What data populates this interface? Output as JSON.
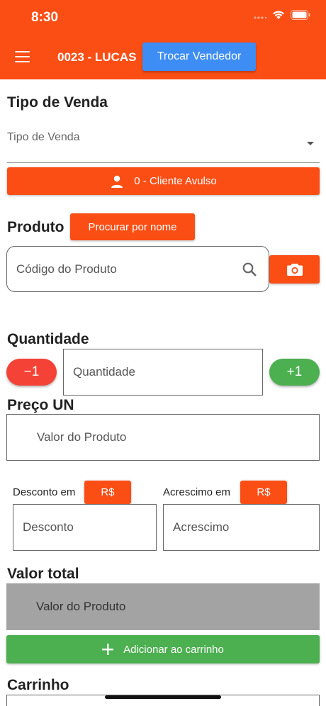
{
  "status_bar": {
    "time": "8:30"
  },
  "appbar": {
    "vendor": "0023 - LUCAS",
    "switch_vendor_label": "Trocar Vendedor"
  },
  "sale_type": {
    "heading": "Tipo de Venda",
    "placeholder": "Tipo de Venda"
  },
  "customer": {
    "label": "0 - Cliente Avulso"
  },
  "product": {
    "heading": "Produto",
    "search_by_name_label": "Procurar por nome",
    "code_placeholder": "Código do Produto"
  },
  "quantity": {
    "heading": "Quantidade",
    "minus_label": "−1",
    "placeholder": "Quantidade",
    "plus_label": "+1"
  },
  "unit_price": {
    "heading": "Preço UN",
    "placeholder": "Valor do Produto"
  },
  "discount": {
    "label": "Desconto em",
    "unit_label": "R$",
    "placeholder": "Desconto"
  },
  "surcharge": {
    "label": "Acrescimo em",
    "unit_label": "R$",
    "placeholder": "Acrescimo"
  },
  "total": {
    "heading": "Valor total",
    "placeholder": "Valor do Produto"
  },
  "cart": {
    "add_label": "Adicionar ao carrinho",
    "heading": "Carrinho"
  },
  "colors": {
    "primary": "#fa4e15",
    "accent_blue": "#3d8df5",
    "green": "#4caf50",
    "red": "#f44336",
    "disabled_gray": "#a3a3a3"
  }
}
